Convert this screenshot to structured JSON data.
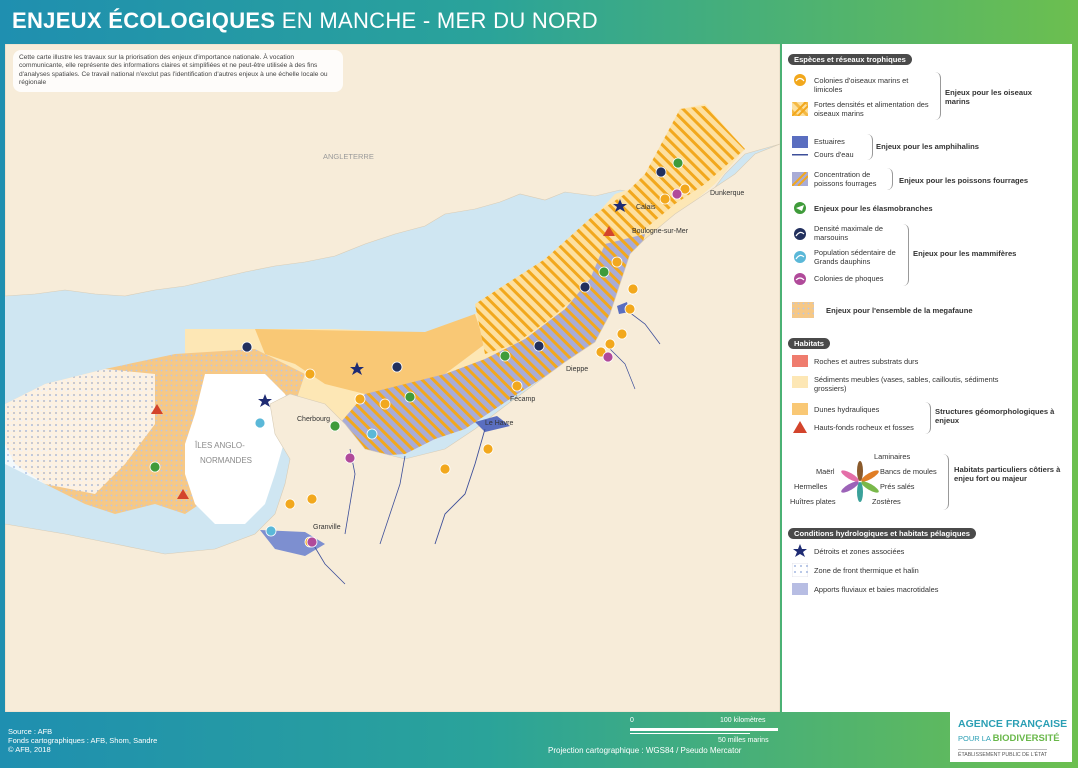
{
  "title": {
    "bold": "ENJEUX ÉCOLOGIQUES",
    "rest": "EN MANCHE - MER DU NORD"
  },
  "intro_text": "Cette carte illustre les travaux sur la priorisation des enjeux d'importance nationale. À vocation communicante, elle représente des informations claires et simplifiées et ne peut-être utilisée à des fins d'analyses spatiales. Ce travail national n'exclut pas l'identification d'autres enjeux à une échelle locale ou régionale",
  "places": {
    "angleterre": "ANGLETERRE",
    "iles_line1": "ÎLES ANGLO-",
    "iles_line2": "NORMANDES",
    "calais": "Calais",
    "dunkerque": "Dunkerque",
    "boulogne": "Boulogne-sur-Mer",
    "dieppe": "Dieppe",
    "fecamp": "Fécamp",
    "le_havre": "Le Havre",
    "cherbourg": "Cherbourg",
    "granville": "Granville"
  },
  "legend": {
    "sec_species": "Espèces et réseaux trophiques",
    "colonies_oiseaux": "Colonies d'oiseaux marins et limicoles",
    "fortes_densites": "Fortes densités et alimentation des oiseaux marins",
    "group_oiseaux": "Enjeux pour les oiseaux marins",
    "estuaires": "Estuaires",
    "cours_eau": "Cours d'eau",
    "group_amphihalins": "Enjeux pour les amphihalins",
    "concentration_poissons": "Concentration de poissons fourrages",
    "group_poissons": "Enjeux pour les poissons fourrages",
    "elasmobranches": "Enjeux pour les élasmobranches",
    "marsouins": "Densité maximale de marsouins",
    "dauphins": "Population sédentaire de Grands dauphins",
    "phoques": "Colonies de phoques",
    "group_mammiferes": "Enjeux pour les mammifères",
    "megafaune": "Enjeux pour l'ensemble de la megafaune",
    "sec_habitats": "Habitats",
    "roches": "Roches et autres substrats durs",
    "sediments": "Sédiments meubles (vases, sables, cailloutis, sédiments grossiers)",
    "dunes": "Dunes hydrauliques",
    "hauts_fonds": "Hauts-fonds rocheux et fosses",
    "group_structures": "Structures géomorphologiques à enjeux",
    "laminaires": "Laminaires",
    "maerl": "Maërl",
    "bancs_moules": "Bancs de moules",
    "hermelles": "Hermelles",
    "pres_sales": "Prés salés",
    "huitres": "Huîtres plates",
    "zosteres": "Zostères",
    "group_habitats_particuliers": "Habitats particuliers côtiers à enjeu fort ou majeur",
    "sec_conditions": "Conditions hydrologiques et habitats pélagiques",
    "detroits": "Détroits et zones associées",
    "front_thermique": "Zone de front thermique et halin",
    "apports_fluviaux": "Apports fluviaux et baies macrotidales"
  },
  "footer": {
    "source": "Source : AFB",
    "fonds": "Fonds cartographiques : AFB, Shom, Sandre",
    "copyright": "© AFB, 2018",
    "scale_zero": "0",
    "scale_km": "100 kilomètres",
    "scale_miles": "50 milles marins",
    "projection": "Projection cartographique : WGS84 / Pseudo Mercator"
  },
  "agency": {
    "line1": "AGENCE FRANÇAISE",
    "line2a": "POUR LA ",
    "line2b": "BIODIVERSITÉ",
    "line3": "ÉTABLISSEMENT PUBLIC DE L'ÉTAT"
  },
  "colors": {
    "sea": "#cfe6f2",
    "land": "#f7ecd9",
    "sediment": "#fde7b5",
    "dunes": "#f9c875",
    "estuary": "#5a6ec0",
    "apports": "#b7bde3",
    "birds": "#f2a81d",
    "elasmo": "#3f9b3a",
    "porpoise": "#22305e",
    "dolphin": "#5bb8d8",
    "seal": "#b04a9a",
    "rock": "#ef7c6e",
    "header_gradient_start": "#1f8fb0",
    "header_gradient_end": "#6cbf4f"
  }
}
